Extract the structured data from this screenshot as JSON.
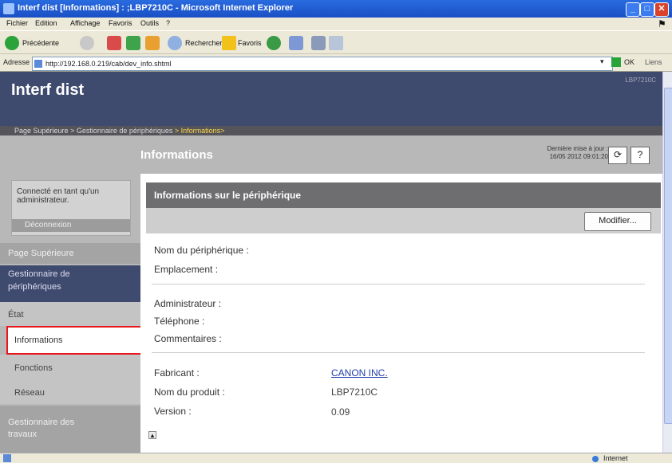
{
  "window": {
    "title": "Interf dist [Informations] : ;LBP7210C - Microsoft Internet Explorer",
    "controls": [
      "_",
      "□",
      "✕"
    ]
  },
  "menu": [
    "Fichier",
    "Edition",
    "Affichage",
    "Favoris",
    "Outils",
    "?"
  ],
  "toolbar": {
    "back": "Précédente",
    "search": "Rechercher",
    "favorites": "Favoris"
  },
  "address": {
    "label": "Adresse",
    "url": "http://192.168.0.219/cab/dev_info.shtml",
    "go": "OK",
    "links": "Liens"
  },
  "page": {
    "brand": "Interf dist",
    "model": "LBP7210C",
    "breadcrumb": {
      "home": "Page Supérieure",
      "sep1": " > ",
      "devmgr": "Gestionnaire de périphériques",
      "current": " > Informations>"
    },
    "title": "Informations",
    "last_update_label": "Dernière mise à jour :",
    "last_update_value": "16/05 2012 09:01:20",
    "refresh_icon": "refresh-icon",
    "help_label": "?"
  },
  "sidebar": {
    "login_text_1": "Connecté en tant qu'un",
    "login_text_2": "administrateur.",
    "logout": "Déconnexion",
    "items": [
      {
        "label": "Page Supérieure"
      },
      {
        "label": "Gestionnaire de"
      },
      {
        "label": "périphériques"
      },
      {
        "label": "État"
      },
      {
        "label": "Informations"
      },
      {
        "label": "Fonctions"
      },
      {
        "label": "Réseau"
      },
      {
        "label": "Gestionnaire des"
      },
      {
        "label": "travaux"
      }
    ]
  },
  "panel": {
    "header": "Informations sur le périphérique",
    "modify": "Modifier...",
    "fields": [
      {
        "label": "Nom du périphérique :",
        "value": ""
      },
      {
        "label": "Emplacement :",
        "value": ""
      },
      {
        "label": "Administrateur :",
        "value": ""
      },
      {
        "label": "Téléphone :",
        "value": ""
      },
      {
        "label": "Commentaires :",
        "value": ""
      },
      {
        "label": "Fabricant :",
        "value": "CANON INC."
      },
      {
        "label": "Nom du produit :",
        "value": "LBP7210C"
      },
      {
        "label": "Version :",
        "value": "0.09"
      }
    ]
  },
  "status": {
    "zone": "Internet"
  },
  "colors": {
    "header_bg": "#3e4a6e",
    "highlight_border": "#e8151b",
    "link": "#1f3fa8"
  }
}
